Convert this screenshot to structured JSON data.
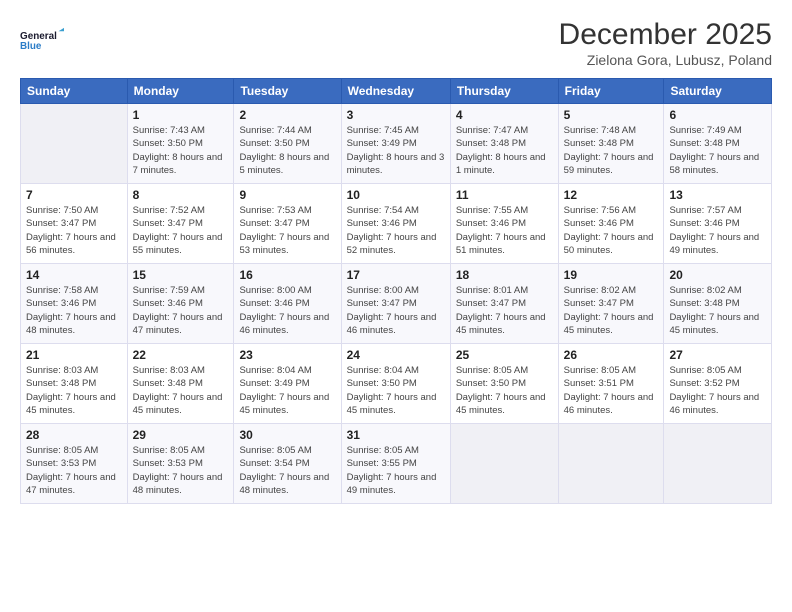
{
  "header": {
    "logo_line1": "General",
    "logo_line2": "Blue",
    "month": "December 2025",
    "location": "Zielona Gora, Lubusz, Poland"
  },
  "days_of_week": [
    "Sunday",
    "Monday",
    "Tuesday",
    "Wednesday",
    "Thursday",
    "Friday",
    "Saturday"
  ],
  "weeks": [
    [
      {
        "day": "",
        "sunrise": "",
        "sunset": "",
        "daylight": ""
      },
      {
        "day": "1",
        "sunrise": "Sunrise: 7:43 AM",
        "sunset": "Sunset: 3:50 PM",
        "daylight": "Daylight: 8 hours and 7 minutes."
      },
      {
        "day": "2",
        "sunrise": "Sunrise: 7:44 AM",
        "sunset": "Sunset: 3:50 PM",
        "daylight": "Daylight: 8 hours and 5 minutes."
      },
      {
        "day": "3",
        "sunrise": "Sunrise: 7:45 AM",
        "sunset": "Sunset: 3:49 PM",
        "daylight": "Daylight: 8 hours and 3 minutes."
      },
      {
        "day": "4",
        "sunrise": "Sunrise: 7:47 AM",
        "sunset": "Sunset: 3:48 PM",
        "daylight": "Daylight: 8 hours and 1 minute."
      },
      {
        "day": "5",
        "sunrise": "Sunrise: 7:48 AM",
        "sunset": "Sunset: 3:48 PM",
        "daylight": "Daylight: 7 hours and 59 minutes."
      },
      {
        "day": "6",
        "sunrise": "Sunrise: 7:49 AM",
        "sunset": "Sunset: 3:48 PM",
        "daylight": "Daylight: 7 hours and 58 minutes."
      }
    ],
    [
      {
        "day": "7",
        "sunrise": "Sunrise: 7:50 AM",
        "sunset": "Sunset: 3:47 PM",
        "daylight": "Daylight: 7 hours and 56 minutes."
      },
      {
        "day": "8",
        "sunrise": "Sunrise: 7:52 AM",
        "sunset": "Sunset: 3:47 PM",
        "daylight": "Daylight: 7 hours and 55 minutes."
      },
      {
        "day": "9",
        "sunrise": "Sunrise: 7:53 AM",
        "sunset": "Sunset: 3:47 PM",
        "daylight": "Daylight: 7 hours and 53 minutes."
      },
      {
        "day": "10",
        "sunrise": "Sunrise: 7:54 AM",
        "sunset": "Sunset: 3:46 PM",
        "daylight": "Daylight: 7 hours and 52 minutes."
      },
      {
        "day": "11",
        "sunrise": "Sunrise: 7:55 AM",
        "sunset": "Sunset: 3:46 PM",
        "daylight": "Daylight: 7 hours and 51 minutes."
      },
      {
        "day": "12",
        "sunrise": "Sunrise: 7:56 AM",
        "sunset": "Sunset: 3:46 PM",
        "daylight": "Daylight: 7 hours and 50 minutes."
      },
      {
        "day": "13",
        "sunrise": "Sunrise: 7:57 AM",
        "sunset": "Sunset: 3:46 PM",
        "daylight": "Daylight: 7 hours and 49 minutes."
      }
    ],
    [
      {
        "day": "14",
        "sunrise": "Sunrise: 7:58 AM",
        "sunset": "Sunset: 3:46 PM",
        "daylight": "Daylight: 7 hours and 48 minutes."
      },
      {
        "day": "15",
        "sunrise": "Sunrise: 7:59 AM",
        "sunset": "Sunset: 3:46 PM",
        "daylight": "Daylight: 7 hours and 47 minutes."
      },
      {
        "day": "16",
        "sunrise": "Sunrise: 8:00 AM",
        "sunset": "Sunset: 3:46 PM",
        "daylight": "Daylight: 7 hours and 46 minutes."
      },
      {
        "day": "17",
        "sunrise": "Sunrise: 8:00 AM",
        "sunset": "Sunset: 3:47 PM",
        "daylight": "Daylight: 7 hours and 46 minutes."
      },
      {
        "day": "18",
        "sunrise": "Sunrise: 8:01 AM",
        "sunset": "Sunset: 3:47 PM",
        "daylight": "Daylight: 7 hours and 45 minutes."
      },
      {
        "day": "19",
        "sunrise": "Sunrise: 8:02 AM",
        "sunset": "Sunset: 3:47 PM",
        "daylight": "Daylight: 7 hours and 45 minutes."
      },
      {
        "day": "20",
        "sunrise": "Sunrise: 8:02 AM",
        "sunset": "Sunset: 3:48 PM",
        "daylight": "Daylight: 7 hours and 45 minutes."
      }
    ],
    [
      {
        "day": "21",
        "sunrise": "Sunrise: 8:03 AM",
        "sunset": "Sunset: 3:48 PM",
        "daylight": "Daylight: 7 hours and 45 minutes."
      },
      {
        "day": "22",
        "sunrise": "Sunrise: 8:03 AM",
        "sunset": "Sunset: 3:48 PM",
        "daylight": "Daylight: 7 hours and 45 minutes."
      },
      {
        "day": "23",
        "sunrise": "Sunrise: 8:04 AM",
        "sunset": "Sunset: 3:49 PM",
        "daylight": "Daylight: 7 hours and 45 minutes."
      },
      {
        "day": "24",
        "sunrise": "Sunrise: 8:04 AM",
        "sunset": "Sunset: 3:50 PM",
        "daylight": "Daylight: 7 hours and 45 minutes."
      },
      {
        "day": "25",
        "sunrise": "Sunrise: 8:05 AM",
        "sunset": "Sunset: 3:50 PM",
        "daylight": "Daylight: 7 hours and 45 minutes."
      },
      {
        "day": "26",
        "sunrise": "Sunrise: 8:05 AM",
        "sunset": "Sunset: 3:51 PM",
        "daylight": "Daylight: 7 hours and 46 minutes."
      },
      {
        "day": "27",
        "sunrise": "Sunrise: 8:05 AM",
        "sunset": "Sunset: 3:52 PM",
        "daylight": "Daylight: 7 hours and 46 minutes."
      }
    ],
    [
      {
        "day": "28",
        "sunrise": "Sunrise: 8:05 AM",
        "sunset": "Sunset: 3:53 PM",
        "daylight": "Daylight: 7 hours and 47 minutes."
      },
      {
        "day": "29",
        "sunrise": "Sunrise: 8:05 AM",
        "sunset": "Sunset: 3:53 PM",
        "daylight": "Daylight: 7 hours and 48 minutes."
      },
      {
        "day": "30",
        "sunrise": "Sunrise: 8:05 AM",
        "sunset": "Sunset: 3:54 PM",
        "daylight": "Daylight: 7 hours and 48 minutes."
      },
      {
        "day": "31",
        "sunrise": "Sunrise: 8:05 AM",
        "sunset": "Sunset: 3:55 PM",
        "daylight": "Daylight: 7 hours and 49 minutes."
      },
      {
        "day": "",
        "sunrise": "",
        "sunset": "",
        "daylight": ""
      },
      {
        "day": "",
        "sunrise": "",
        "sunset": "",
        "daylight": ""
      },
      {
        "day": "",
        "sunrise": "",
        "sunset": "",
        "daylight": ""
      }
    ]
  ]
}
